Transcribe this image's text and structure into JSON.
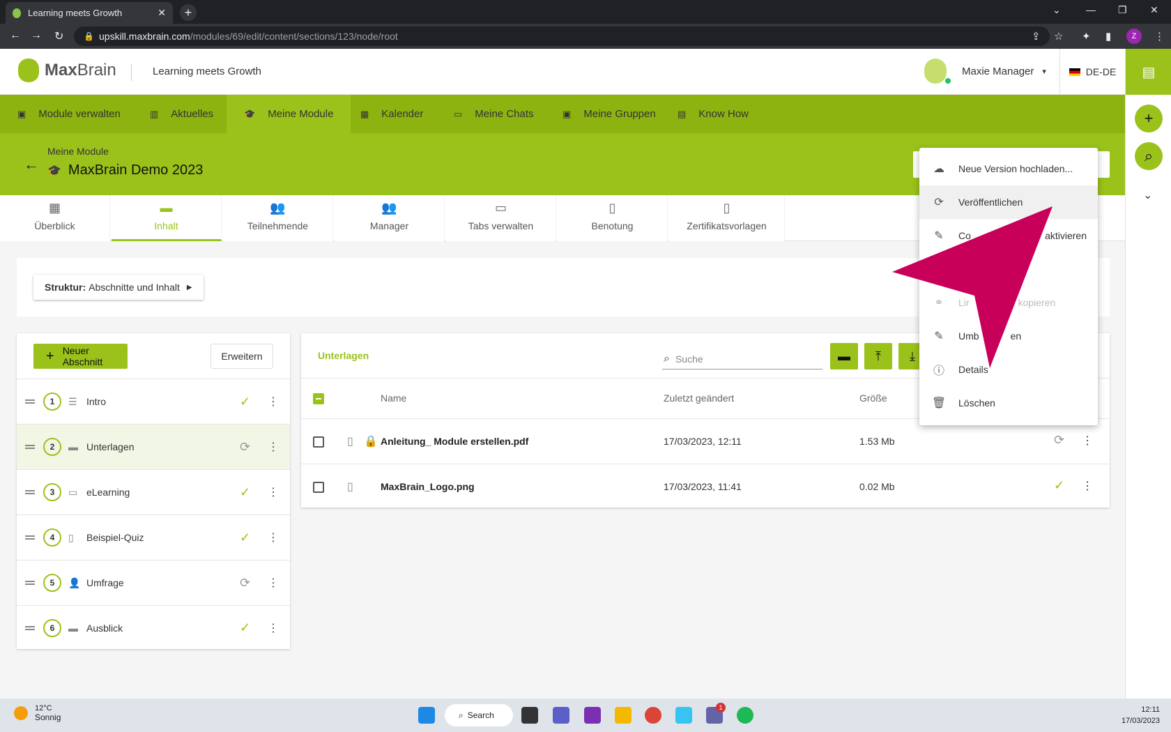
{
  "browser": {
    "tab_title": "Learning meets Growth",
    "url_domain": "upskill.maxbrain.com",
    "url_path": "/modules/69/edit/content/sections/123/node/root",
    "profile_initial": "Z"
  },
  "header": {
    "logo_max": "Max",
    "logo_brain": "Brain",
    "tagline": "Learning meets Growth",
    "user_name": "Maxie Manager",
    "language": "DE-DE"
  },
  "main_nav": [
    {
      "label": "Module verwalten"
    },
    {
      "label": "Aktuelles"
    },
    {
      "label": "Meine Module"
    },
    {
      "label": "Kalender"
    },
    {
      "label": "Meine Chats"
    },
    {
      "label": "Meine Gruppen"
    },
    {
      "label": "Know How"
    }
  ],
  "hero": {
    "breadcrumb": "Meine Module",
    "title": "MaxBrain Demo 2023"
  },
  "sub_tabs": [
    {
      "label": "Überblick"
    },
    {
      "label": "Inhalt"
    },
    {
      "label": "Teilnehmende"
    },
    {
      "label": "Manager"
    },
    {
      "label": "Tabs verwalten"
    },
    {
      "label": "Benotung"
    },
    {
      "label": "Zertifikatsvorlagen"
    }
  ],
  "structure": {
    "label_bold": "Struktur:",
    "label": "Abschnitte und Inhalt"
  },
  "sections_panel": {
    "new_section": "Neuer Abschnitt",
    "expand": "Erweitern",
    "items": [
      {
        "num": "1",
        "label": "Intro",
        "status": "published"
      },
      {
        "num": "2",
        "label": "Unterlagen",
        "status": "pending"
      },
      {
        "num": "3",
        "label": "eLearning",
        "status": "published"
      },
      {
        "num": "4",
        "label": "Beispiel-Quiz",
        "status": "published"
      },
      {
        "num": "5",
        "label": "Umfrage",
        "status": "pending"
      },
      {
        "num": "6",
        "label": "Ausblick",
        "status": "published"
      }
    ]
  },
  "files_panel": {
    "title": "Unterlagen",
    "search_placeholder": "Suche",
    "columns": {
      "name": "Name",
      "modified": "Zuletzt geändert",
      "size": "Größe"
    },
    "rows": [
      {
        "name": "Anleitung_ Module erstellen.pdf",
        "modified": "17/03/2023, 12:11",
        "size": "1.53 Mb",
        "status": "pending"
      },
      {
        "name": "MaxBrain_Logo.png",
        "modified": "17/03/2023, 11:41",
        "size": "0.02 Mb",
        "status": "published"
      }
    ]
  },
  "context_menu": [
    {
      "label": "Neue Version hochladen...",
      "icon": "cloud-upload-icon"
    },
    {
      "label": "Veröffentlichen",
      "icon": "sync-icon"
    },
    {
      "label": "Co",
      "label_tail": "aktivieren",
      "icon": "pencil-icon"
    },
    {
      "label": "Lir",
      "label_tail": "kopieren",
      "icon": "link-icon"
    },
    {
      "label": "Umb",
      "label_tail": "en",
      "icon": "pencil-icon"
    },
    {
      "label": "Details",
      "icon": "info-icon"
    },
    {
      "label": "Löschen",
      "icon": "trash-icon"
    }
  ],
  "colors": {
    "accent": "#9bc21b",
    "accent_dark": "#8db311",
    "pointer": "#c8005a"
  },
  "taskbar": {
    "temp": "12°C",
    "weather": "Sonnig",
    "search": "Search",
    "time": "12:11",
    "date": "17/03/2023",
    "teams_badge": "1"
  }
}
